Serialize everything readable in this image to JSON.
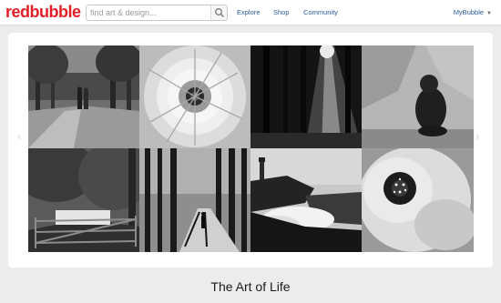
{
  "header": {
    "logo_part1": "red",
    "logo_part2": "bubble",
    "search_placeholder": "find art & design...",
    "nav": [
      "Explore",
      "Shop",
      "Community"
    ],
    "account_label": "MyBubble"
  },
  "carousel": {
    "prev_arrow": "‹",
    "next_arrow": "›",
    "photos": [
      {
        "name": "couple-walking-park",
        "subject": "tree-lined path with couple"
      },
      {
        "name": "chrysanthemum-flower",
        "subject": "flower close-up"
      },
      {
        "name": "forest-sunbeams",
        "subject": "sunbeams through trees"
      },
      {
        "name": "gorilla-on-rock",
        "subject": "gorilla sitting on rock"
      },
      {
        "name": "garden-gate-trees",
        "subject": "wooden gate under trees"
      },
      {
        "name": "woodland-walk",
        "subject": "figure walking in woods"
      },
      {
        "name": "lighthouse-waves",
        "subject": "lighthouse with crashing waves"
      },
      {
        "name": "flower-macro",
        "subject": "flower center macro"
      }
    ]
  },
  "collection": {
    "title": "The Art of Life"
  },
  "colors": {
    "brand_red": "#e21f26",
    "link_blue": "#2a5a9a"
  },
  "icons": {
    "search": "search-icon",
    "caret": "chevron-down-icon"
  }
}
